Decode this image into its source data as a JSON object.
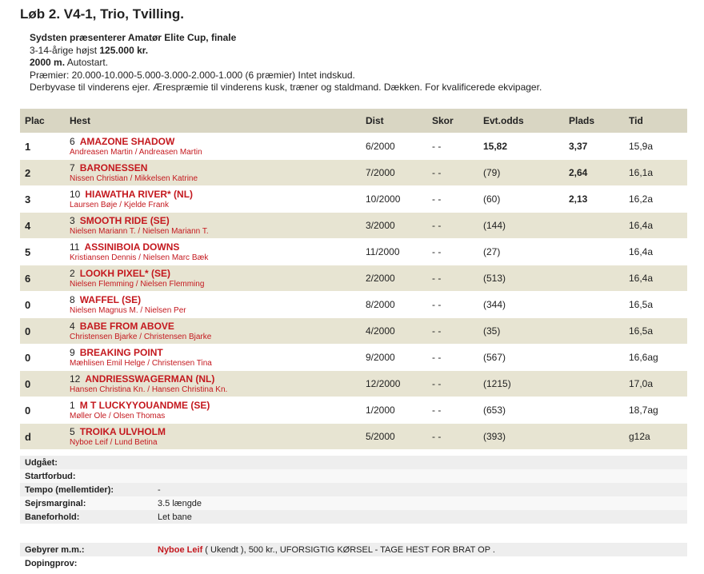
{
  "race": {
    "title": "Løb 2. V4-1, Trio, Tvilling.",
    "line1": "Sydsten præsenterer Amatør Elite Cup, finale",
    "line2_pre": "3-14-årige højst ",
    "line2_bold": "125.000 kr.",
    "line3_bold": "2000 m.",
    "line3_rest": " Autostart.",
    "line4": "Præmier: 20.000-10.000-5.000-3.000-2.000-1.000 (6 præmier) Intet indskud.",
    "line5": "Derbyvase til vinderens ejer. Ærespræmie til vinderens kusk, træner og staldmand. Dækken. For kvalificerede ekvipager."
  },
  "columns": [
    "Plac",
    "Hest",
    "Dist",
    "Skor",
    "Evt.odds",
    "Plads",
    "Tid"
  ],
  "rows": [
    {
      "plac": "1",
      "num": "6",
      "name": "AMAZONE SHADOW",
      "people": "Andreasen Martin / Andreasen Martin",
      "dist": "6/2000",
      "skor": "- -",
      "odds": "15,82",
      "plads": "3,37",
      "tid": "15,9a"
    },
    {
      "plac": "2",
      "num": "7",
      "name": "BARONESSEN",
      "people": "Nissen Christian / Mikkelsen Katrine",
      "dist": "7/2000",
      "skor": "- -",
      "odds": "(79)",
      "plads": "2,64",
      "tid": "16,1a"
    },
    {
      "plac": "3",
      "num": "10",
      "name": "HIAWATHA RIVER* (NL)",
      "people": "Laursen Bøje / Kjelde Frank",
      "dist": "10/2000",
      "skor": "- -",
      "odds": "(60)",
      "plads": "2,13",
      "tid": "16,2a"
    },
    {
      "plac": "4",
      "num": "3",
      "name": "SMOOTH RIDE (SE)",
      "people": "Nielsen Mariann T. / Nielsen Mariann T.",
      "dist": "3/2000",
      "skor": "- -",
      "odds": "(144)",
      "plads": "",
      "tid": "16,4a"
    },
    {
      "plac": "5",
      "num": "11",
      "name": "ASSINIBOIA DOWNS",
      "people": "Kristiansen Dennis / Nielsen Marc Bæk",
      "dist": "11/2000",
      "skor": "- -",
      "odds": "(27)",
      "plads": "",
      "tid": "16,4a"
    },
    {
      "plac": "6",
      "num": "2",
      "name": "LOOKH PIXEL* (SE)",
      "people": "Nielsen Flemming / Nielsen Flemming",
      "dist": "2/2000",
      "skor": "- -",
      "odds": "(513)",
      "plads": "",
      "tid": "16,4a"
    },
    {
      "plac": "0",
      "num": "8",
      "name": "WAFFEL (SE)",
      "people": "Nielsen Magnus M. / Nielsen Per",
      "dist": "8/2000",
      "skor": "- -",
      "odds": "(344)",
      "plads": "",
      "tid": "16,5a"
    },
    {
      "plac": "0",
      "num": "4",
      "name": "BABE FROM ABOVE",
      "people": "Christensen Bjarke / Christensen Bjarke",
      "dist": "4/2000",
      "skor": "- -",
      "odds": "(35)",
      "plads": "",
      "tid": "16,5a"
    },
    {
      "plac": "0",
      "num": "9",
      "name": "BREAKING POINT",
      "people": "Mæhlisen Emil Helge / Christensen Tina",
      "dist": "9/2000",
      "skor": "- -",
      "odds": "(567)",
      "plads": "",
      "tid": "16,6ag"
    },
    {
      "plac": "0",
      "num": "12",
      "name": "ANDRIESSWAGERMAN (NL)",
      "people": "Hansen Christina Kn. / Hansen Christina Kn.",
      "dist": "12/2000",
      "skor": "- -",
      "odds": "(1215)",
      "plads": "",
      "tid": "17,0a"
    },
    {
      "plac": "0",
      "num": "1",
      "name": "M T LUCKYYOUANDME (SE)",
      "people": "Møller Ole / Olsen Thomas",
      "dist": "1/2000",
      "skor": "- -",
      "odds": "(653)",
      "plads": "",
      "tid": "18,7ag"
    },
    {
      "plac": "d",
      "num": "5",
      "name": "TROIKA ULVHOLM",
      "people": "Nyboe Leif / Lund Betina",
      "dist": "5/2000",
      "skor": "- -",
      "odds": "(393)",
      "plads": "",
      "tid": "g12a"
    }
  ],
  "meta": [
    {
      "label": "Udgået:",
      "value": ""
    },
    {
      "label": "Startforbud:",
      "value": ""
    },
    {
      "label": "Tempo (mellemtider):",
      "value": "-"
    },
    {
      "label": "Sejrsmarginal:",
      "value": "3.5 længde"
    },
    {
      "label": "Baneforhold:",
      "value": "Let bane"
    }
  ],
  "fees": {
    "label": "Gebyrer m.m.:",
    "name": "Nyboe Leif",
    "text": " ( Ukendt ), 500 kr., UFORSIGTIG KØRSEL - TAGE HEST FOR BRAT OP .",
    "doping_label": "Dopingprov:",
    "doping_value": ""
  }
}
